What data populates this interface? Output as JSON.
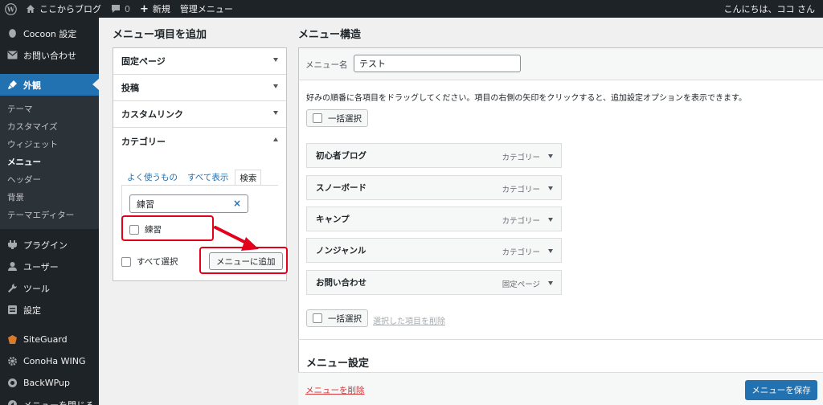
{
  "adminbar": {
    "site_name": "ここからブログ",
    "comments_count": "0",
    "new_label": "新規",
    "admin_menu_label": "管理メニュー",
    "greeting": "こんにちは、ココ さん"
  },
  "sidebar": {
    "items_top": [
      {
        "label": "Cocoon 設定",
        "icon": "cocoon-icon"
      },
      {
        "label": "お問い合わせ",
        "icon": "mail-icon"
      }
    ],
    "current": {
      "label": "外観",
      "icon": "paintbrush-icon"
    },
    "submenu": [
      "テーマ",
      "カスタマイズ",
      "ウィジェット",
      "メニュー",
      "ヘッダー",
      "背景",
      "テーマエディター"
    ],
    "submenu_active_index": 3,
    "items_bottom": [
      {
        "label": "プラグイン",
        "icon": "plugin-icon"
      },
      {
        "label": "ユーザー",
        "icon": "user-icon"
      },
      {
        "label": "ツール",
        "icon": "wrench-icon"
      },
      {
        "label": "設定",
        "icon": "settings-icon"
      },
      {
        "label": "SiteGuard",
        "icon": "siteguard-icon"
      },
      {
        "label": "ConoHa WING",
        "icon": "gear-icon"
      },
      {
        "label": "BackWPup",
        "icon": "backwpup-icon"
      },
      {
        "label": "メニューを閉じる",
        "icon": "collapse-icon"
      }
    ]
  },
  "add_panel": {
    "title": "メニュー項目を追加",
    "sections": [
      "固定ページ",
      "投稿",
      "カスタムリンク",
      "カテゴリー"
    ],
    "tabs": [
      "よく使うもの",
      "すべて表示",
      "検索"
    ],
    "search_value": "練習",
    "result_label": "練習",
    "select_all_label": "すべて選択",
    "add_button_label": "メニューに追加"
  },
  "structure": {
    "title": "メニュー構造",
    "menu_name_label": "メニュー名",
    "menu_name_value": "テスト",
    "instructions": "好みの順番に各項目をドラッグしてください。項目の右側の矢印をクリックすると、追加設定オプションを表示できます。",
    "bulk_select_label": "一括選択",
    "items": [
      {
        "title": "初心者ブログ",
        "type": "カテゴリー"
      },
      {
        "title": "スノーボード",
        "type": "カテゴリー"
      },
      {
        "title": "キャンプ",
        "type": "カテゴリー"
      },
      {
        "title": "ノンジャンル",
        "type": "カテゴリー"
      },
      {
        "title": "お問い合わせ",
        "type": "固定ページ"
      }
    ],
    "remove_selected_label": "選択した項目を削除",
    "settings_title": "メニュー設定",
    "delete_menu_label": "メニューを削除",
    "save_button_label": "メニューを保存"
  },
  "colors": {
    "accent": "#2271b1",
    "highlight": "#e3001b",
    "admin_dark": "#1d2327"
  }
}
